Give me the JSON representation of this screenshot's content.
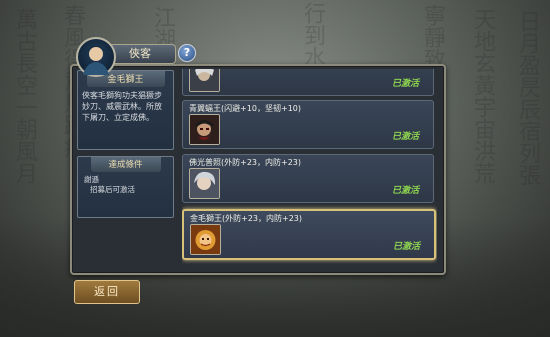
{
  "header": {
    "tab_label": "俠客",
    "help_label": "?"
  },
  "left_panel": {
    "title": "金毛獅王",
    "description": "俠客毛獅狗功夫猖獗步妙刀、威震武林。所放下屠刀、立定成佛。",
    "conditions_title": "達成條件",
    "conditions_line1": "謝遜",
    "conditions_line2": "招募后可激活"
  },
  "cards": [
    {
      "label": "",
      "status": "已激活"
    },
    {
      "label": "青翼蝠王(闪避+10，坚韧+10)",
      "status": "已激活"
    },
    {
      "label": "佛光普照(外防+23，内防+23)",
      "status": "已激活"
    },
    {
      "label": "金毛獅王(外防+23，内防+23)",
      "status": "已激活"
    }
  ],
  "footer": {
    "back_label": "返回"
  },
  "colors": {
    "active_status": "#8ed44f",
    "selected_border": "#d8c27a"
  }
}
